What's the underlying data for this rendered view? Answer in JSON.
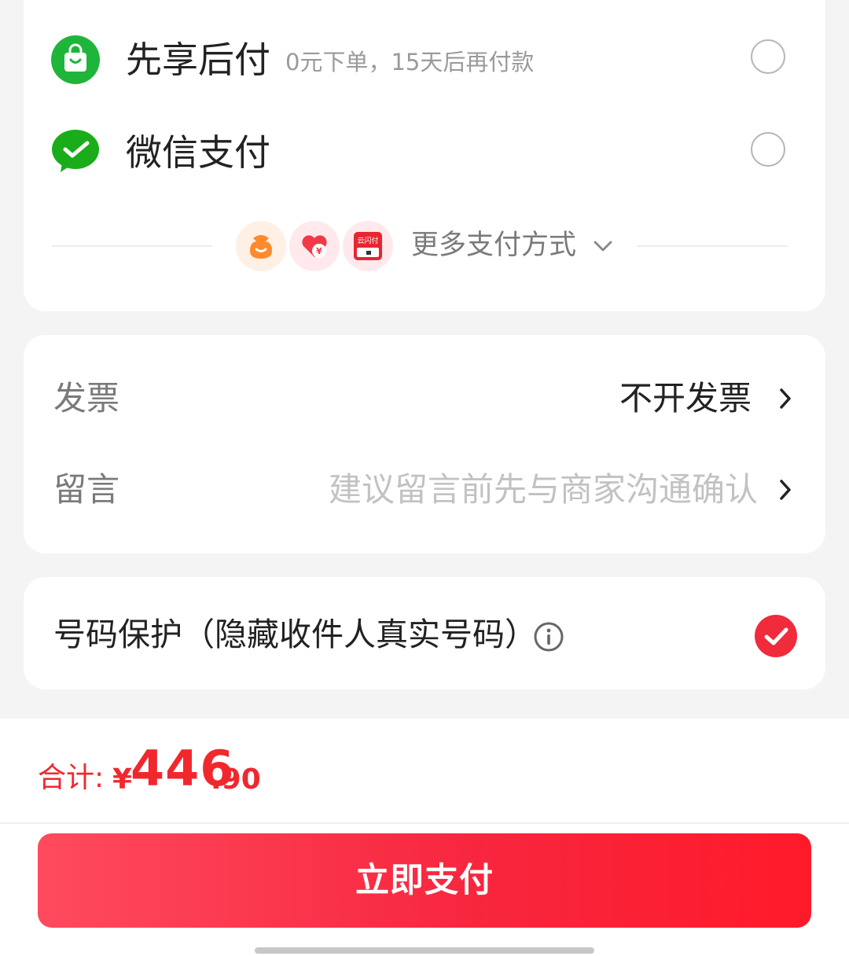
{
  "payment_methods": [
    {
      "name": "先享后付",
      "desc": "0元下单，15天后再付款",
      "icon": "shopping-bag-icon",
      "selected": false,
      "accent": "#1fb53a"
    },
    {
      "name": "微信支付",
      "icon": "wechat-pay-icon",
      "selected": false,
      "accent": "#1aad19"
    }
  ],
  "more_payment": {
    "label": "更多支付方式",
    "icons": [
      "money-bag-icon",
      "heart-yuan-icon",
      "pay-card-icon"
    ],
    "badge_text": "云闪付"
  },
  "invoice": {
    "label": "发票",
    "value": "不开发票"
  },
  "message": {
    "label": "留言",
    "placeholder": "建议留言前先与商家沟通确认"
  },
  "number_protection": {
    "label": "号码保护（隐藏收件人真实号码）",
    "checked": true
  },
  "total": {
    "label": "合计:",
    "currency": "¥",
    "integer": "446",
    "decimal": ".90"
  },
  "pay_button": {
    "label": "立即支付"
  },
  "colors": {
    "accent_red": "#f0282e",
    "button_red": "#f7273f",
    "check_red": "#f02b3c"
  }
}
